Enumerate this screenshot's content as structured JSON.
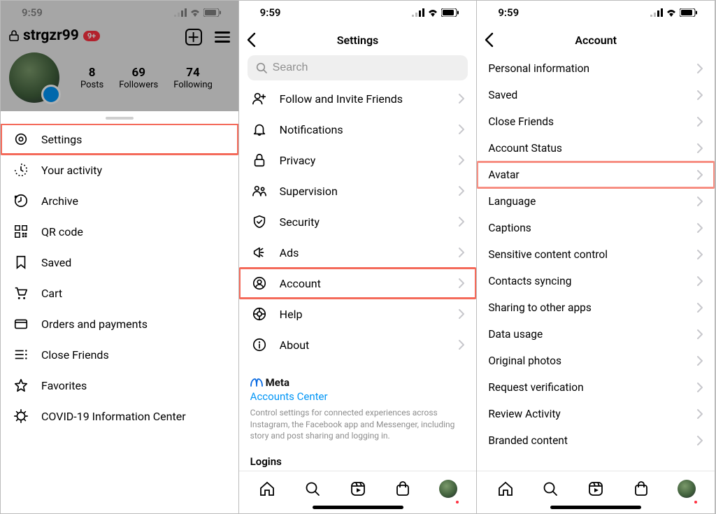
{
  "status": {
    "time": "9:59"
  },
  "p1": {
    "username": "strgzr99",
    "badge": "9+",
    "stats": {
      "posts": {
        "num": "8",
        "label": "Posts"
      },
      "followers": {
        "num": "69",
        "label": "Followers"
      },
      "following": {
        "num": "74",
        "label": "Following"
      }
    },
    "menu": [
      {
        "label": "Settings",
        "icon": "gear-icon",
        "hl": true
      },
      {
        "label": "Your activity",
        "icon": "activity-icon",
        "hl": false
      },
      {
        "label": "Archive",
        "icon": "archive-icon",
        "hl": false
      },
      {
        "label": "QR code",
        "icon": "qrcode-icon",
        "hl": false
      },
      {
        "label": "Saved",
        "icon": "bookmark-icon",
        "hl": false
      },
      {
        "label": "Cart",
        "icon": "cart-icon",
        "hl": false
      },
      {
        "label": "Orders and payments",
        "icon": "card-icon",
        "hl": false
      },
      {
        "label": "Close Friends",
        "icon": "closefriends-icon",
        "hl": false
      },
      {
        "label": "Favorites",
        "icon": "star-icon",
        "hl": false
      },
      {
        "label": "COVID-19 Information Center",
        "icon": "covid-icon",
        "hl": false
      }
    ]
  },
  "p2": {
    "title": "Settings",
    "search_placeholder": "Search",
    "items": [
      {
        "label": "Follow and Invite Friends",
        "icon": "adduser-icon",
        "hl": false
      },
      {
        "label": "Notifications",
        "icon": "bell-icon",
        "hl": false
      },
      {
        "label": "Privacy",
        "icon": "lock-icon",
        "hl": false
      },
      {
        "label": "Supervision",
        "icon": "supervision-icon",
        "hl": false
      },
      {
        "label": "Security",
        "icon": "shield-icon",
        "hl": false
      },
      {
        "label": "Ads",
        "icon": "ads-icon",
        "hl": false
      },
      {
        "label": "Account",
        "icon": "account-icon",
        "hl": true
      },
      {
        "label": "Help",
        "icon": "help-icon",
        "hl": false
      },
      {
        "label": "About",
        "icon": "info-icon",
        "hl": false
      }
    ],
    "meta_brand": "Meta",
    "accounts_center": "Accounts Center",
    "meta_desc": "Control settings for connected experiences across Instagram, the Facebook app and Messenger, including story and post sharing and logging in.",
    "logins_header": "Logins"
  },
  "p3": {
    "title": "Account",
    "items": [
      {
        "label": "Personal information",
        "hl": false
      },
      {
        "label": "Saved",
        "hl": false
      },
      {
        "label": "Close Friends",
        "hl": false
      },
      {
        "label": "Account Status",
        "hl": false
      },
      {
        "label": "Avatar",
        "hl": true
      },
      {
        "label": "Language",
        "hl": false
      },
      {
        "label": "Captions",
        "hl": false
      },
      {
        "label": "Sensitive content control",
        "hl": false
      },
      {
        "label": "Contacts syncing",
        "hl": false
      },
      {
        "label": "Sharing to other apps",
        "hl": false
      },
      {
        "label": "Data usage",
        "hl": false
      },
      {
        "label": "Original photos",
        "hl": false
      },
      {
        "label": "Request verification",
        "hl": false
      },
      {
        "label": "Review Activity",
        "hl": false
      },
      {
        "label": "Branded content",
        "hl": false
      }
    ]
  }
}
